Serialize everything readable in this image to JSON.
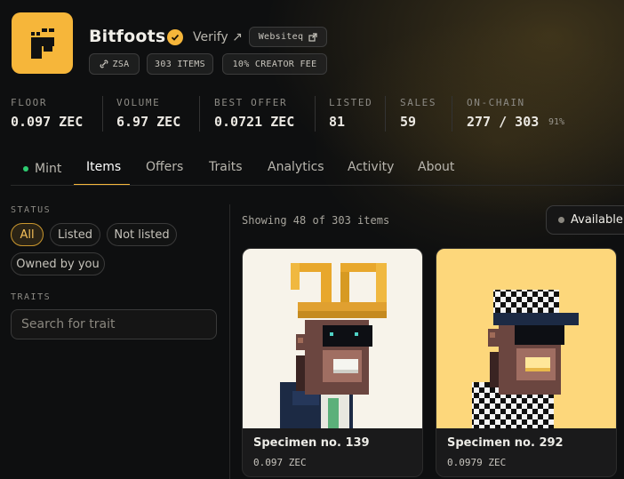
{
  "collection": {
    "name": "Bitfoots",
    "verify_label": "Verify ↗",
    "website_label": "Websiteq",
    "chips": [
      "ZSA",
      "303 ITEMS",
      "10% CREATOR FEE"
    ],
    "brand_color": "#f6b63a"
  },
  "stats": [
    {
      "label": "FLOOR",
      "value": "0.097 ZEC"
    },
    {
      "label": "VOLUME",
      "value": "6.97 ZEC"
    },
    {
      "label": "BEST OFFER",
      "value": "0.0721 ZEC"
    },
    {
      "label": "LISTED",
      "value": "81"
    },
    {
      "label": "SALES",
      "value": "59"
    },
    {
      "label": "ON-CHAIN",
      "value": "277 / 303",
      "suffix": "91%"
    }
  ],
  "tabs": [
    "Mint",
    "Items",
    "Offers",
    "Traits",
    "Analytics",
    "Activity",
    "About"
  ],
  "active_tab": "Items",
  "filters": {
    "status_label": "STATUS",
    "status_options": [
      "All",
      "Listed",
      "Not listed",
      "Owned by you"
    ],
    "selected_status": "All",
    "traits_label": "TRAITS",
    "trait_search_placeholder": "Search for trait"
  },
  "results": {
    "count_text": "Showing 48 of 303 items",
    "availability_label": "Available"
  },
  "items": [
    {
      "name": "Specimen no. 139",
      "price": "0.097 ZEC",
      "bg_color": "#f7f3ea"
    },
    {
      "name": "Specimen no. 292",
      "price": "0.0979 ZEC",
      "bg_color": "#fdd77b"
    }
  ]
}
